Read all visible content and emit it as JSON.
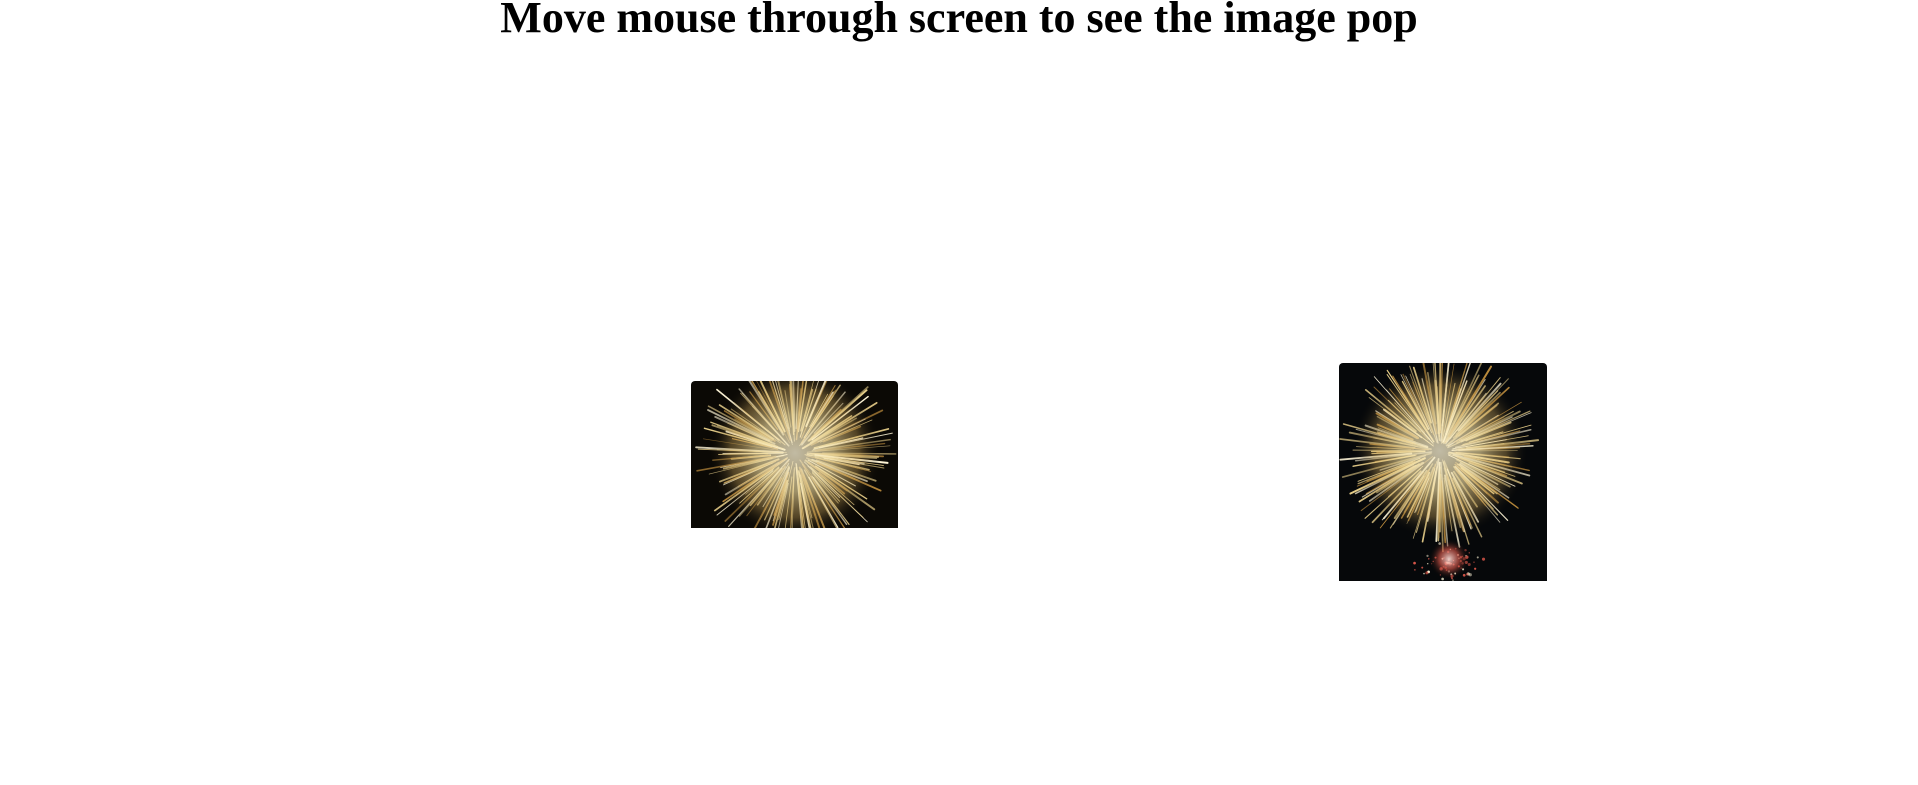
{
  "header": {
    "title": "Move mouse through screen to see the image pop"
  },
  "images": [
    {
      "name": "fireworks-image-left",
      "subject": "fireworks-burst"
    },
    {
      "name": "fireworks-image-right",
      "subject": "fireworks-burst"
    }
  ],
  "colors": {
    "background": "#ffffff",
    "title": "#000000",
    "sky": "#0b0905",
    "burst_core": "#fff6d8",
    "burst_gold": "#e8cf8a",
    "burst_amber": "#b8893c",
    "sparks_red": "#d9574a"
  }
}
